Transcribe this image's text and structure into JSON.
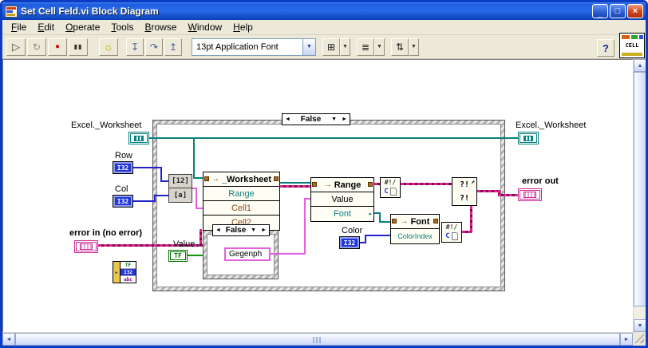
{
  "window": {
    "title": "Set Cell Feld.vi Block Diagram",
    "controls": {
      "minimize": "_",
      "maximize": "□",
      "close": "×"
    }
  },
  "menu": {
    "items": [
      "File",
      "Edit",
      "Operate",
      "Tools",
      "Browse",
      "Window",
      "Help"
    ]
  },
  "toolbar": {
    "font_selector": "13pt Application Font",
    "help_label": "?",
    "vi_icon_text": "CELL",
    "icons": {
      "run": "▷",
      "run_continuous": "↻",
      "abort": "●",
      "pause": "▮▮",
      "highlight": "☼",
      "step_into": "↧",
      "step_over": "↷",
      "step_out": "↥",
      "align": "⊞",
      "distribute": "≣",
      "reorder": "⇅",
      "dropdown": "▼"
    }
  },
  "scrollbar_icons": {
    "up": "▲",
    "down": "▼",
    "left": "◄",
    "right": "►"
  },
  "diagram": {
    "labels": {
      "excel_left": "Excel._Worksheet",
      "excel_right": "Excel._Worksheet",
      "row": "Row",
      "col": "Col",
      "error_in": "error in (no error)",
      "error_out": "error out",
      "value": "Value",
      "color": "Color"
    },
    "outer_case": {
      "selector": "False"
    },
    "inner_case": {
      "selector": "False"
    },
    "string_constant": "Gegenph",
    "invoke_worksheet": {
      "title": "_Worksheet",
      "rows": [
        "Range",
        "Cell1",
        "Cell2"
      ]
    },
    "range_node": {
      "title": "Range",
      "rows": [
        "Value",
        "Font"
      ]
    },
    "font_node": {
      "title": "Font",
      "rows": [
        "ColorIndex"
      ]
    },
    "index_node": {
      "rows": [
        "[12]",
        "[a]"
      ]
    },
    "conv_node": {
      "top": "#!/",
      "bottom": "C"
    },
    "merge_node": {
      "rows": [
        "?!",
        "?!"
      ],
      "arrow": "↗"
    },
    "misc_node": {
      "rows": [
        "TF",
        "I32",
        "abc"
      ]
    },
    "terminals": {
      "i32": "I32",
      "tf": "TF"
    },
    "icons": {
      "sel_left": "◄",
      "sel_right": "►",
      "sel_down": "▼",
      "invoke_arrow": "→",
      "expand": "▸"
    }
  },
  "colors": {
    "wire_teal": "#0a8080",
    "wire_blue": "#2222cc",
    "wire_pink": "#e45fe0",
    "wire_green": "#0d980d",
    "err_a": "#e02090",
    "err_b": "#7a0c4e",
    "term_blue": "#2236d8",
    "term_green": "#007000",
    "term_pink": "#cc2f9a",
    "term_teal": "#0a8080",
    "text_teal": "#0a7d7d",
    "text_maroon": "#8a4513"
  }
}
